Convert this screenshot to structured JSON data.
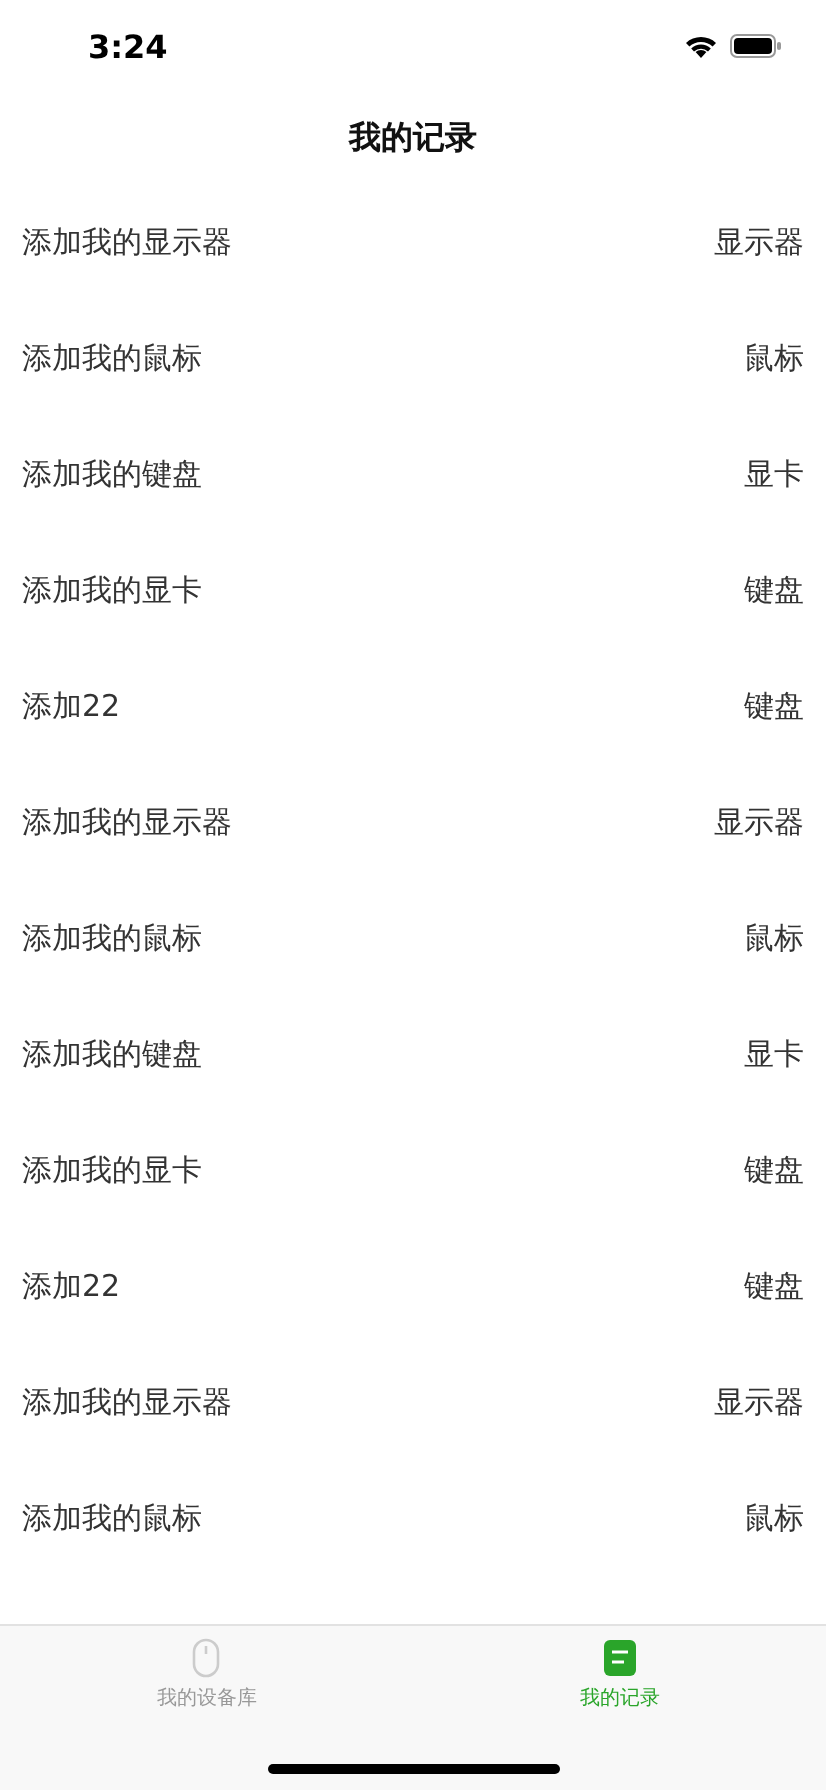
{
  "status_bar": {
    "time": "3:24"
  },
  "nav": {
    "title": "我的记录"
  },
  "records": [
    {
      "name": "添加我的显示器",
      "category": "显示器"
    },
    {
      "name": "添加我的鼠标",
      "category": "鼠标"
    },
    {
      "name": "添加我的键盘",
      "category": "显卡"
    },
    {
      "name": "添加我的显卡",
      "category": "键盘"
    },
    {
      "name": "添加22",
      "category": "键盘"
    },
    {
      "name": "添加我的显示器",
      "category": "显示器"
    },
    {
      "name": "添加我的鼠标",
      "category": "鼠标"
    },
    {
      "name": "添加我的键盘",
      "category": "显卡"
    },
    {
      "name": "添加我的显卡",
      "category": "键盘"
    },
    {
      "name": "添加22",
      "category": "键盘"
    },
    {
      "name": "添加我的显示器",
      "category": "显示器"
    },
    {
      "name": "添加我的鼠标",
      "category": "鼠标"
    }
  ],
  "tabs": [
    {
      "label": "我的设备库",
      "kind": "mouse",
      "selected": false
    },
    {
      "label": "我的记录",
      "kind": "record",
      "selected": true
    }
  ]
}
